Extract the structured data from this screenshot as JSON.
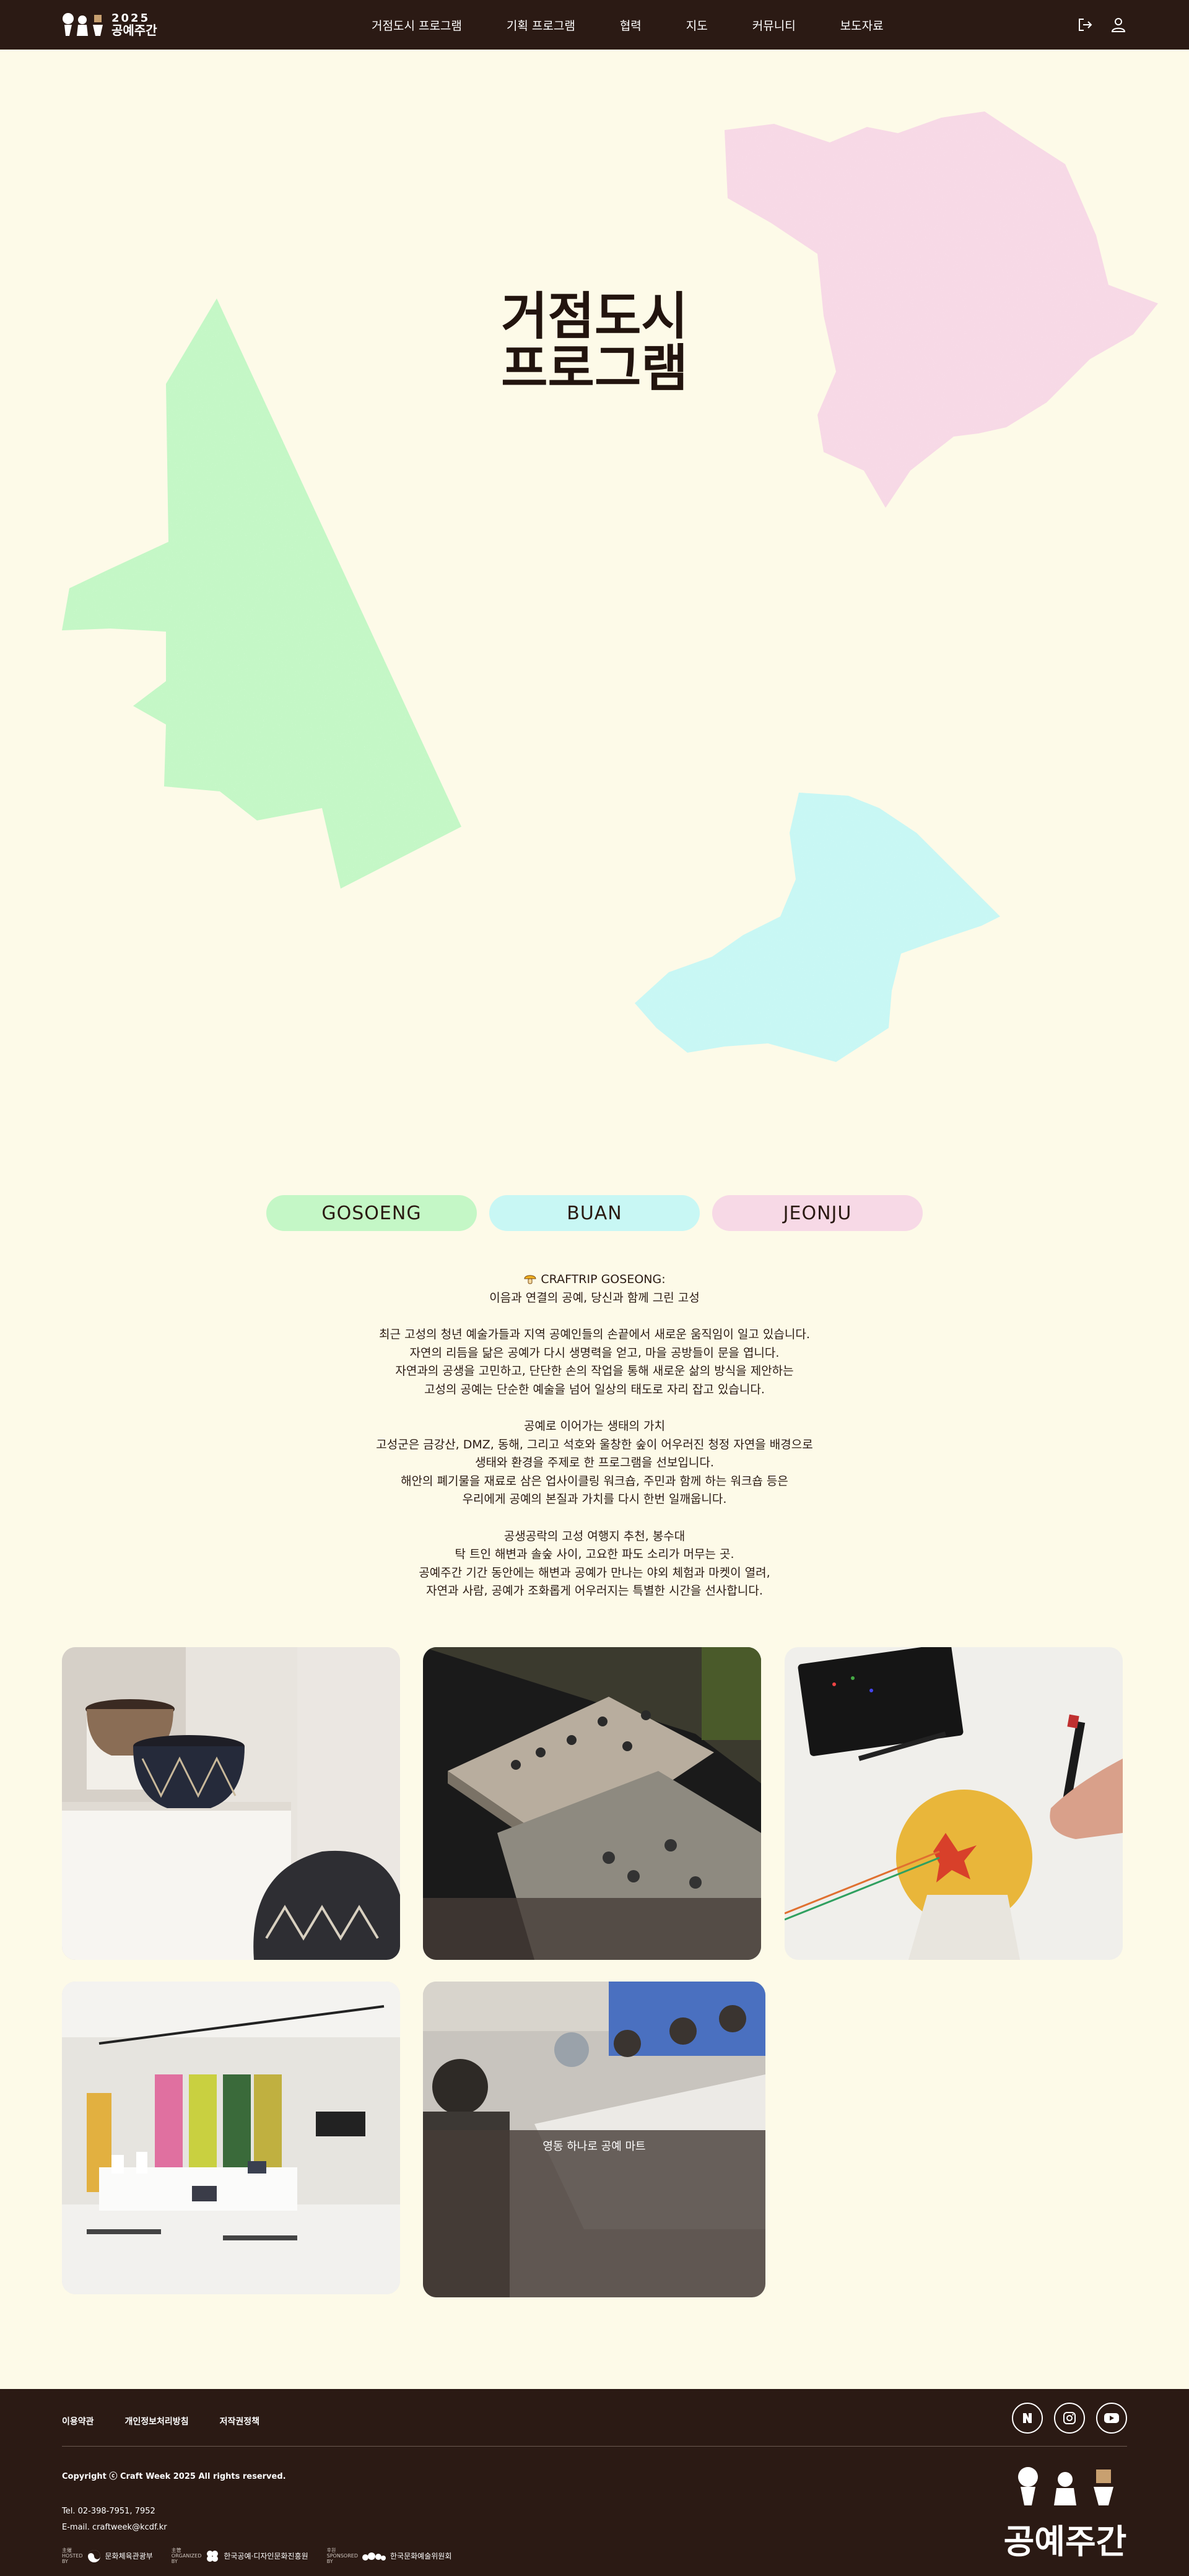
{
  "header": {
    "logo_year": "2025",
    "logo_name": "공예주간",
    "nav": [
      "거점도시 프로그램",
      "기획 프로그램",
      "협력",
      "지도",
      "커뮤니티",
      "보도자료"
    ],
    "icons": [
      "logout-icon",
      "user-icon"
    ]
  },
  "hero": {
    "title_line1": "거점도시",
    "title_line2": "프로그램"
  },
  "tabs": [
    "GOSOENG",
    "BUAN",
    "JEONJU"
  ],
  "description": {
    "intro_title": "CRAFTRIP GOSEONG:",
    "intro_sub": "이음과 연결의 공예, 당신과 함께 그린 고성",
    "p1": [
      "최근 고성의 청년 예술가들과 지역 공예인들의 손끝에서 새로운 움직임이 일고 있습니다.",
      "자연의 리듬을 닮은 공예가 다시 생명력을 얻고, 마을 공방들이 문을 엽니다.",
      "자연과의 공생을 고민하고, 단단한 손의 작업을 통해 새로운 삶의 방식을 제안하는",
      "고성의 공예는 단순한 예술을 넘어 일상의 태도로 자리 잡고 있습니다."
    ],
    "p2": [
      "공예로 이어가는 생태의 가치",
      "고성군은 금강산, DMZ, 동해, 그리고 석호와 울창한 숲이 어우러진 청정 자연을 배경으로",
      "생태와 환경을 주제로 한 프로그램을 선보입니다.",
      "해안의 폐기물을 재료로 삼은 업사이클링 워크숍, 주민과 함께 하는 워크숍 등은",
      "우리에게 공예의 본질과 가치를 다시 한번 일깨웁니다."
    ],
    "p3": [
      "공생공락의 고성 여행지 추천, 봉수대",
      "탁 트인 해변과 솔숲 사이, 고요한 파도 소리가 머무는 곳.",
      "공예주간 기간 동안에는 해변과 공예가 만나는 야외 체험과 마켓이 열려,",
      "자연과 사람, 공예가 조화롭게 어우러지는 특별한 시간을 선사합니다."
    ]
  },
  "gallery": {
    "overlay_caption": "영동 하나로 공예 마트"
  },
  "footer": {
    "links": [
      "이용약관",
      "개인정보처리방침",
      "저작권정책"
    ],
    "social": [
      "naver-icon",
      "instagram-icon",
      "youtube-icon"
    ],
    "copyright": "Copyright ⓒ Craft Week 2025 All rights reserved.",
    "tel": "Tel. 02-398-7951, 7952",
    "email": "E-mail. craftweek@kcdf.kr",
    "partners": [
      {
        "tag": "主催\nHOSTED\nBY",
        "name": "문화체육관광부"
      },
      {
        "tag": "主管\nORGANIZED\nBY",
        "name": "한국공예·디자인문화진흥원"
      },
      {
        "tag": "후원\nSPONSORED\nBY",
        "name": "한국문화예술위원회"
      }
    ],
    "logo_name": "공예주간"
  },
  "colors": {
    "header_bg": "#2b1a14",
    "page_bg": "#fdfae8",
    "green": "#c4f7c6",
    "cyan": "#c8f7f4",
    "pink": "#f7d9e6"
  }
}
